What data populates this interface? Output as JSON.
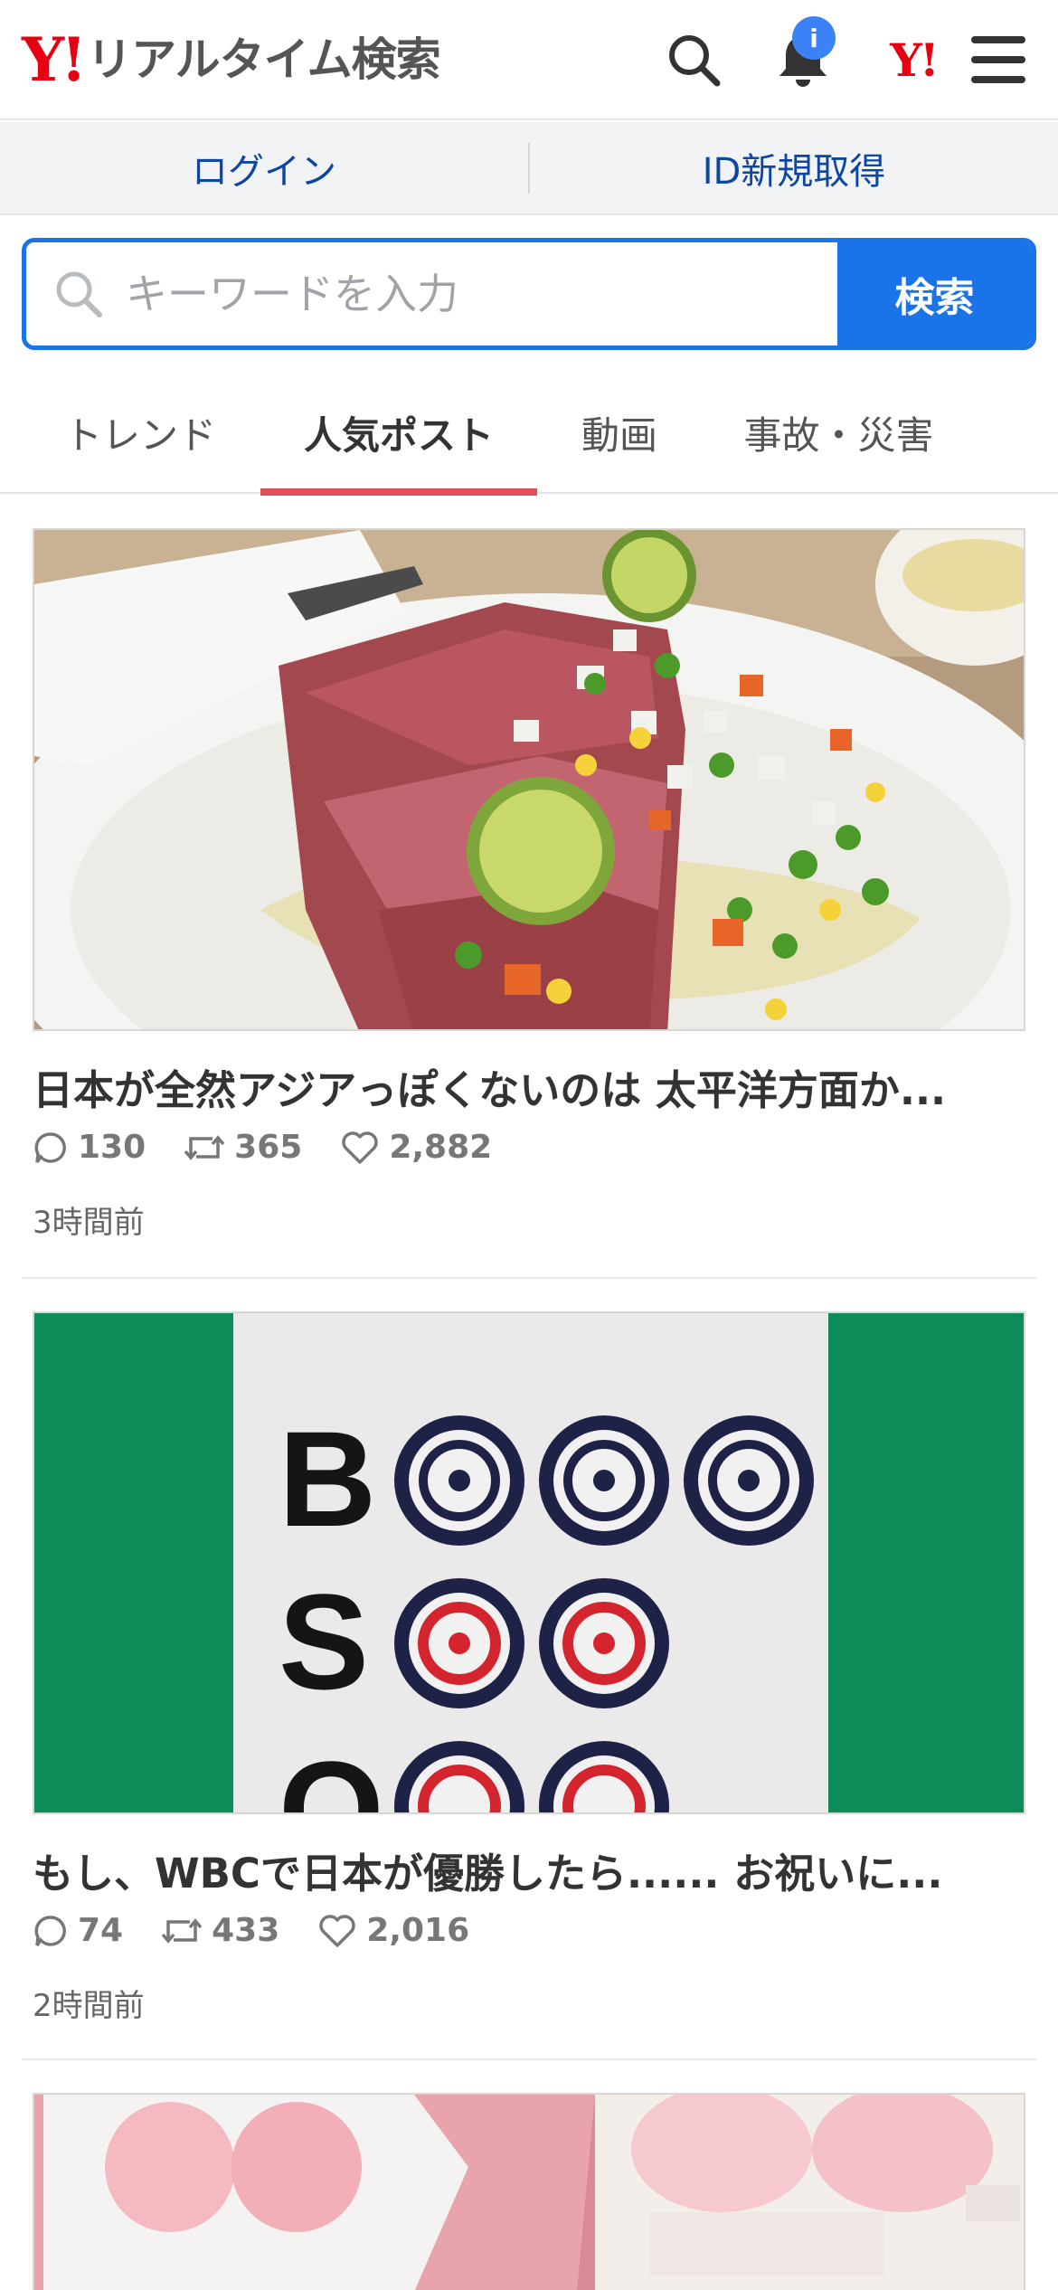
{
  "header": {
    "logo_mark": "Y!",
    "logo_text": "リアルタイム検索",
    "notification_badge": "i",
    "yj_mark": "Y!"
  },
  "login_bar": {
    "login": "ログイン",
    "signup": "ID新規取得"
  },
  "search": {
    "placeholder": "キーワードを入力",
    "button": "検索"
  },
  "tabs": [
    {
      "label": "トレンド",
      "active": false
    },
    {
      "label": "人気ポスト",
      "active": true
    },
    {
      "label": "動画",
      "active": false
    },
    {
      "label": "事故・災害",
      "active": false
    }
  ],
  "posts": [
    {
      "title": "日本が全然アジアっぽくないのは 太平洋方面か...",
      "replies": "130",
      "reposts": "365",
      "likes": "2,882",
      "time": "3時間前",
      "image": "tuna-tataki-photo"
    },
    {
      "title": "もし、WBCで日本が優勝したら...... お祝いに...",
      "replies": "74",
      "reposts": "433",
      "likes": "2,016",
      "time": "2時間前",
      "image": "mahjong-bso-tiles-photo",
      "image_text": [
        "B",
        "S",
        "O"
      ]
    },
    {
      "image": "pink-mochi-photo"
    }
  ],
  "colors": {
    "brand_red": "#e60012",
    "link_blue": "#0d47a1",
    "search_blue": "#1a73e8",
    "tab_underline": "#e0505a",
    "badge_blue": "#3b82f6"
  }
}
